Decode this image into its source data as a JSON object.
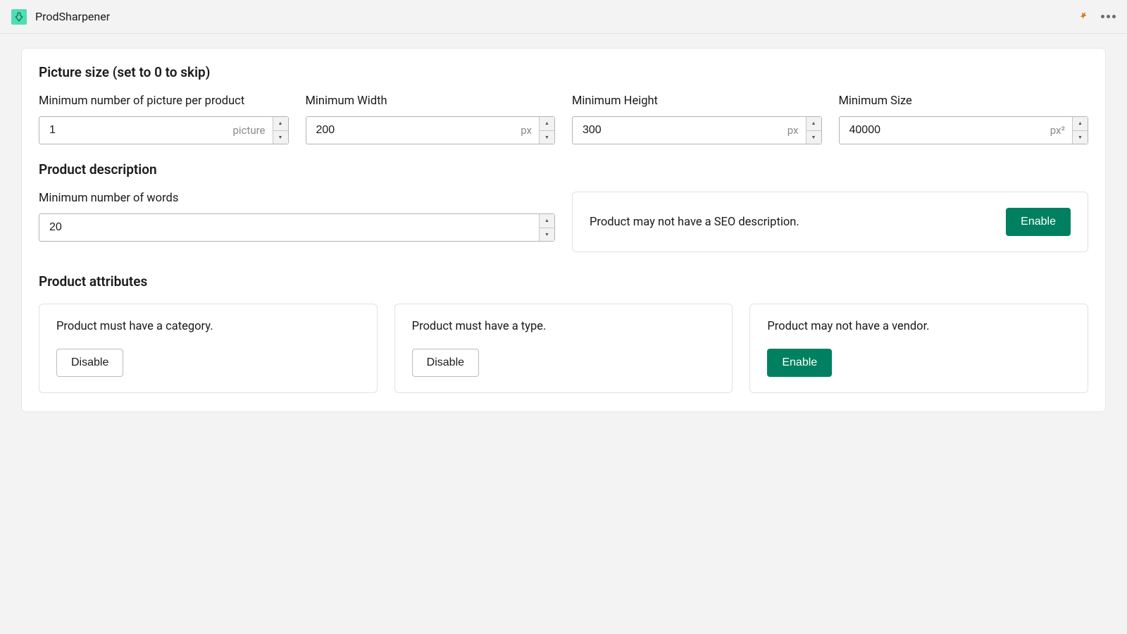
{
  "header": {
    "app_name": "ProdSharpener"
  },
  "sections": {
    "picture": {
      "title": "Picture size (set to 0 to skip)",
      "min_count": {
        "label": "Minimum number of picture per product",
        "value": "1",
        "unit": "picture"
      },
      "min_width": {
        "label": "Minimum Width",
        "value": "200",
        "unit": "px"
      },
      "min_height": {
        "label": "Minimum Height",
        "value": "300",
        "unit": "px"
      },
      "min_size": {
        "label": "Minimum Size",
        "value": "40000",
        "unit": "px²"
      }
    },
    "description": {
      "title": "Product description",
      "min_words": {
        "label": "Minimum number of words",
        "value": "20"
      },
      "seo_notice": "Product may not have a SEO description.",
      "seo_button": "Enable"
    },
    "attributes": {
      "title": "Product attributes",
      "cards": [
        {
          "text": "Product must have a category.",
          "button": "Disable",
          "style": "outline"
        },
        {
          "text": "Product must have a type.",
          "button": "Disable",
          "style": "outline"
        },
        {
          "text": "Product may not have a vendor.",
          "button": "Enable",
          "style": "green"
        }
      ]
    }
  }
}
